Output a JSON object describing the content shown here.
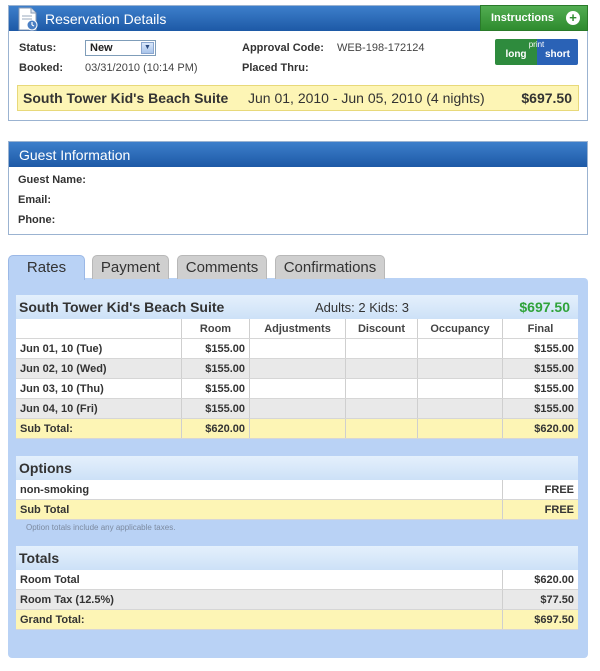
{
  "reservation": {
    "title": "Reservation Details",
    "instructions_label": "Instructions",
    "status_label": "Status:",
    "status_value": "New",
    "booked_label": "Booked:",
    "booked_value": "03/31/2010 (10:14 PM)",
    "approval_label": "Approval Code:",
    "approval_value": "WEB-198-172124",
    "placed_label": "Placed Thru:",
    "print": {
      "caption": "print",
      "long": "long",
      "short": "short"
    },
    "summary": {
      "room": "South Tower Kid's Beach Suite",
      "dates": "Jun 01, 2010 - Jun 05, 2010 (4 nights)",
      "total": "$697.50"
    }
  },
  "guest": {
    "title": "Guest Information",
    "name_label": "Guest Name:",
    "email_label": "Email:",
    "phone_label": "Phone:"
  },
  "tabs": [
    "Rates",
    "Payment",
    "Comments",
    "Confirmations"
  ],
  "rates": {
    "room": "South Tower Kid's Beach Suite",
    "occupants": "Adults: 2 Kids: 3",
    "total": "$697.50",
    "total_color": "#2fa33a",
    "columns": [
      "Room",
      "Adjustments",
      "Discount",
      "Occupancy",
      "Final"
    ],
    "rows": [
      {
        "date": "Jun 01, 10 (Tue)",
        "room": "$155.00",
        "final": "$155.00"
      },
      {
        "date": "Jun 02, 10 (Wed)",
        "room": "$155.00",
        "final": "$155.00"
      },
      {
        "date": "Jun 03, 10 (Thu)",
        "room": "$155.00",
        "final": "$155.00"
      },
      {
        "date": "Jun 04, 10 (Fri)",
        "room": "$155.00",
        "final": "$155.00"
      }
    ],
    "subtotal_label": "Sub Total:",
    "subtotal_room": "$620.00",
    "subtotal_final": "$620.00"
  },
  "options": {
    "title": "Options",
    "items": [
      {
        "name": "non-smoking",
        "value": "FREE"
      }
    ],
    "subtotal_label": "Sub Total",
    "subtotal_value": "FREE",
    "note": "Option totals include any applicable taxes."
  },
  "totals": {
    "title": "Totals",
    "room_total_label": "Room Total",
    "room_total_value": "$620.00",
    "tax_label": "Room Tax (12.5%)",
    "tax_value": "$77.50",
    "grand_label": "Grand Total:",
    "grand_value": "$697.50"
  }
}
